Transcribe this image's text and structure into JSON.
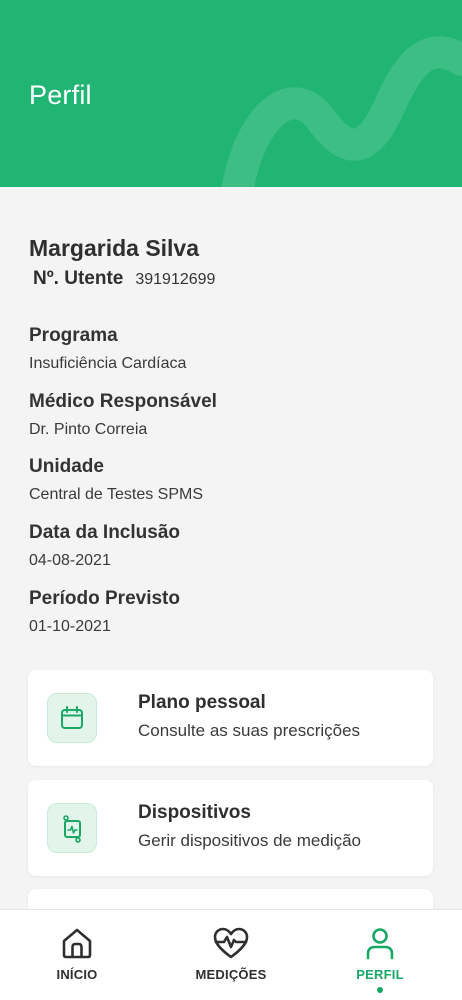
{
  "header": {
    "title": "Perfil"
  },
  "profile": {
    "name": "Margarida Silva",
    "utente_label": "Nº. Utente",
    "utente_value": "391912699"
  },
  "info": [
    {
      "label": "Programa",
      "value": "Insuficiência Cardíaca"
    },
    {
      "label": "Médico Responsável",
      "value": "Dr. Pinto Correia"
    },
    {
      "label": "Unidade",
      "value": "Central de Testes SPMS"
    },
    {
      "label": "Data da Inclusão",
      "value": "04-08-2021"
    },
    {
      "label": "Período Previsto",
      "value": "01-10-2021"
    }
  ],
  "cards": [
    {
      "title": "Plano pessoal",
      "subtitle": "Consulte as suas prescrições",
      "icon": "calendar-icon"
    },
    {
      "title": "Dispositivos",
      "subtitle": "Gerir dispositivos de medição",
      "icon": "device-icon"
    },
    {
      "title": "",
      "subtitle": "",
      "icon": ""
    }
  ],
  "tabbar": {
    "tabs": [
      {
        "label": "INÍCIO",
        "icon": "home-icon",
        "active": false
      },
      {
        "label": "MEDIÇÕES",
        "icon": "heart-pulse-icon",
        "active": false
      },
      {
        "label": "PERFIL",
        "icon": "user-icon",
        "active": true
      }
    ]
  },
  "colors": {
    "primary": "#21b573",
    "accent": "#18a765",
    "background": "#f4f4f4"
  }
}
